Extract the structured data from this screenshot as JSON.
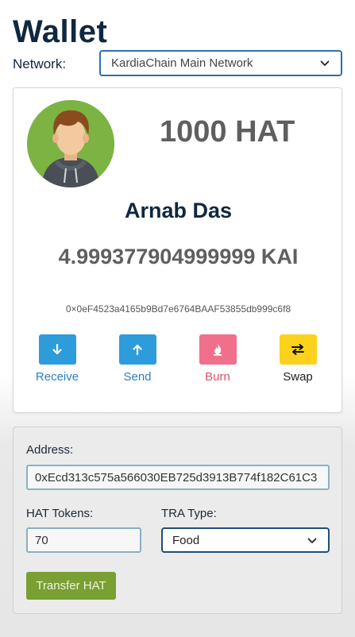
{
  "page": {
    "title": "Wallet"
  },
  "network": {
    "label": "Network:",
    "selected": "KardiaChain Main Network"
  },
  "profile": {
    "hat_balance": "1000 HAT",
    "name": "Arnab Das",
    "kai_balance": "4.999377904999999 KAI",
    "address": "0×0eF4523a4165b9Bd7e6764BAAF53855db999c6f8"
  },
  "actions": [
    {
      "label": "Receive",
      "icon": "arrow-down-icon",
      "color": "#2d9cdb",
      "text_color": "#2c7fc2"
    },
    {
      "label": "Send",
      "icon": "arrow-up-icon",
      "color": "#2d9cdb",
      "text_color": "#2c7fc2"
    },
    {
      "label": "Burn",
      "icon": "flame-icon",
      "color": "#f06f8a",
      "text_color": "#e0506d"
    },
    {
      "label": "Swap",
      "icon": "swap-arrows-icon",
      "color": "#fcd21d",
      "text_color": "#222222"
    }
  ],
  "transfer_form": {
    "address_label": "Address:",
    "address_value": "0xEcd313c575a566030EB725d3913B774f182C61C3",
    "tokens_label": "HAT Tokens:",
    "tokens_value": "70",
    "type_label": "TRA Type:",
    "type_selected": "Food",
    "submit_label": "Transfer HAT"
  }
}
